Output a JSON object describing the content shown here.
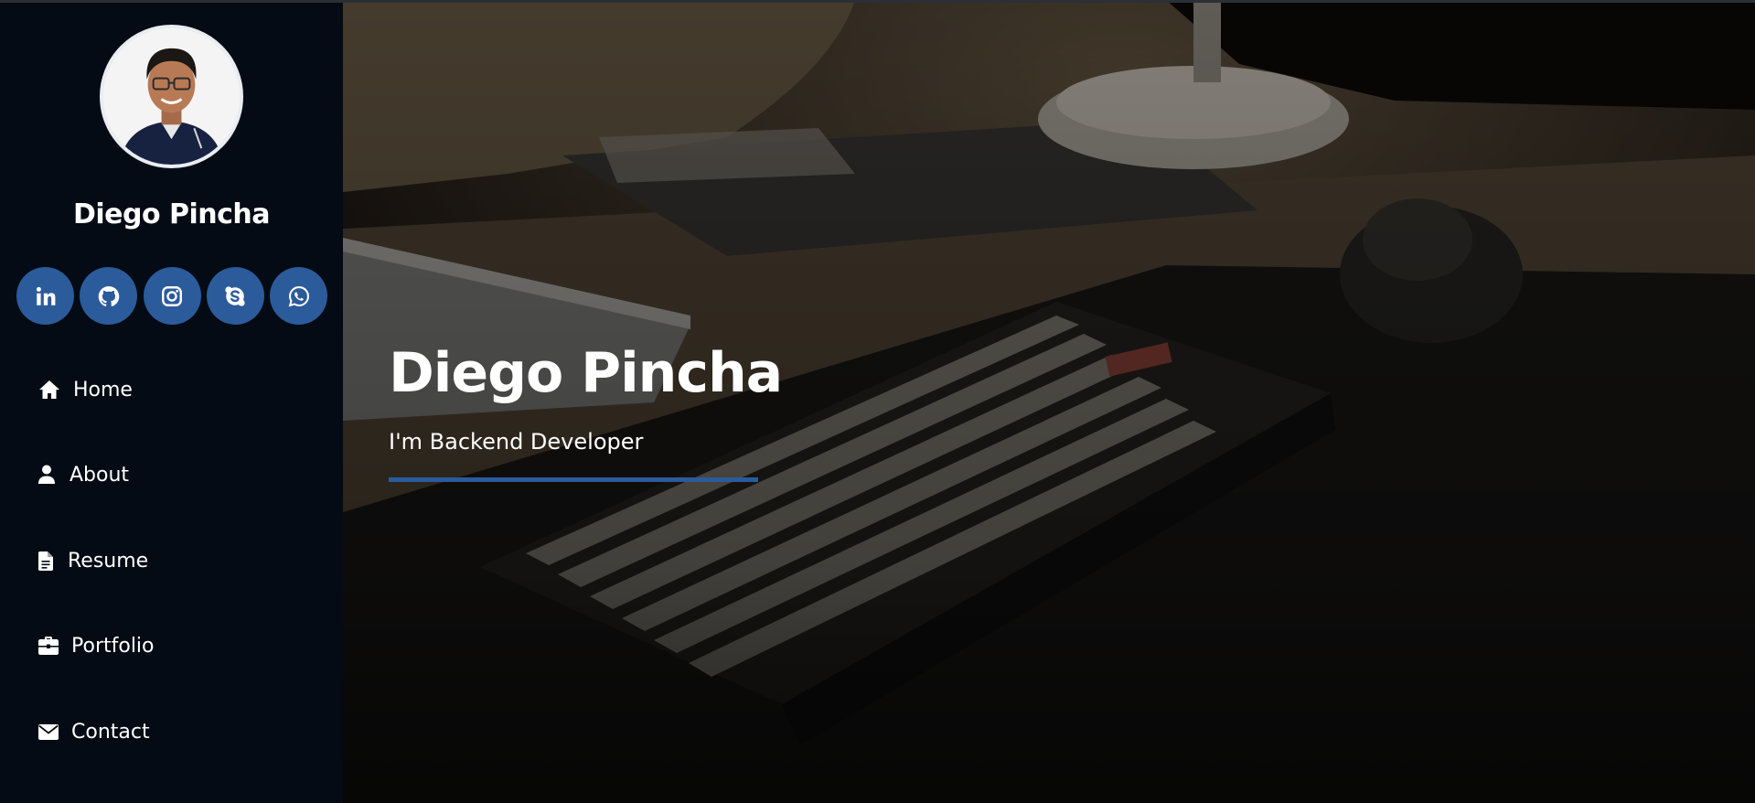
{
  "profile": {
    "name": "Diego Pincha"
  },
  "socials": [
    {
      "icon": "linkedin-icon",
      "label": "LinkedIn"
    },
    {
      "icon": "github-icon",
      "label": "GitHub"
    },
    {
      "icon": "instagram-icon",
      "label": "Instagram"
    },
    {
      "icon": "skype-icon",
      "label": "Skype"
    },
    {
      "icon": "whatsapp-icon",
      "label": "WhatsApp"
    }
  ],
  "nav": {
    "items": [
      {
        "label": "Home",
        "icon": "home-icon"
      },
      {
        "label": "About",
        "icon": "user-icon"
      },
      {
        "label": "Resume",
        "icon": "file-icon"
      },
      {
        "label": "Portfolio",
        "icon": "briefcase-icon"
      },
      {
        "label": "Contact",
        "icon": "envelope-icon"
      }
    ]
  },
  "hero": {
    "title": "Diego Pincha",
    "subtitle": "I'm Backend Developer"
  },
  "colors": {
    "sidebar_bg": "#040b14",
    "accent": "#2c5b9b",
    "text": "#ffffff"
  }
}
